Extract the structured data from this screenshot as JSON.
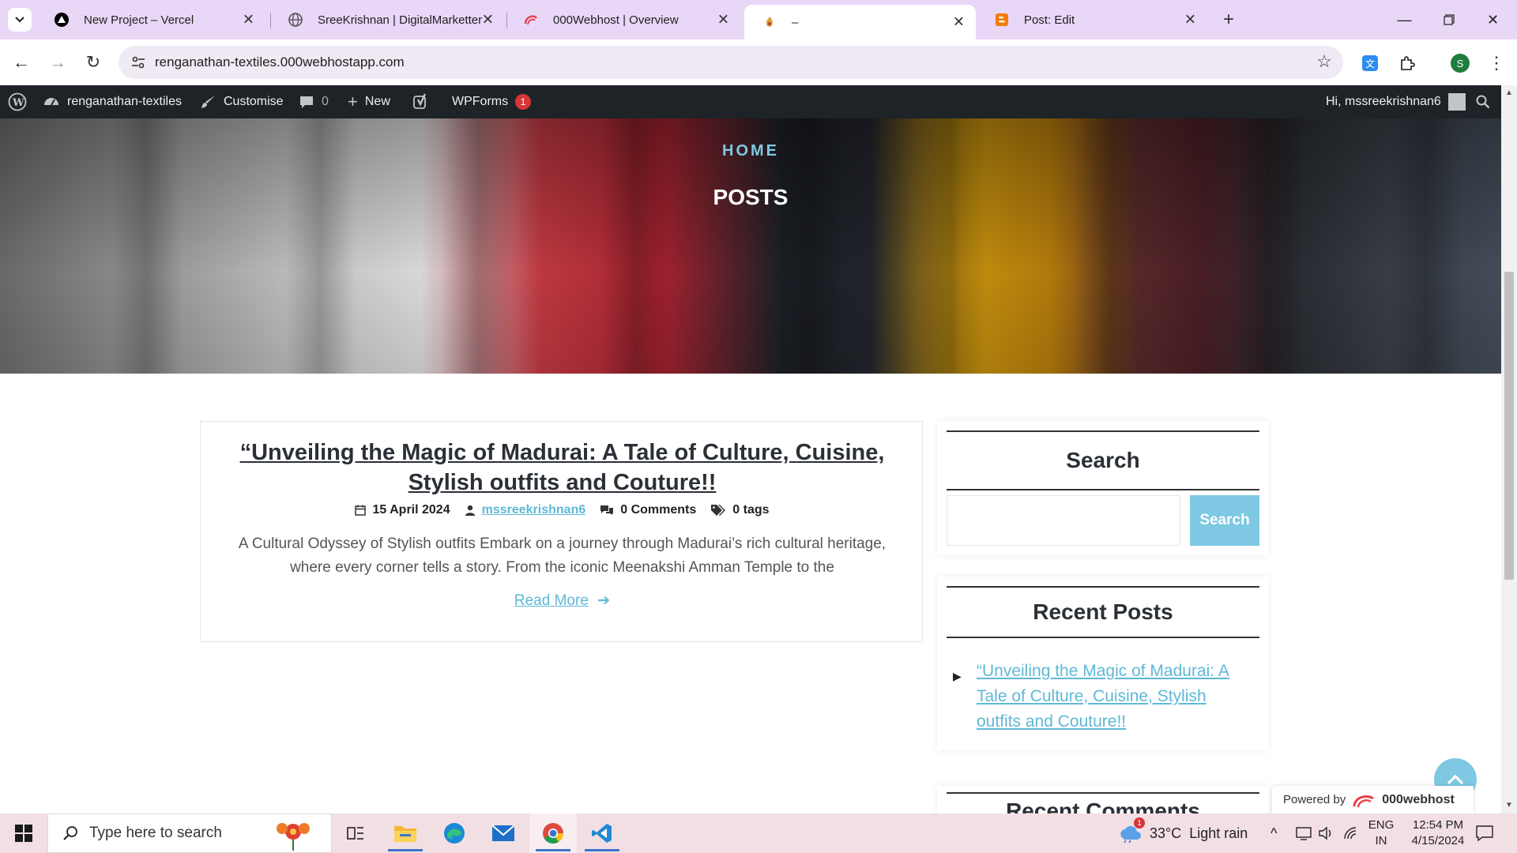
{
  "browser": {
    "tabs": [
      {
        "title": "New Project – Vercel",
        "icon": "vercel-icon",
        "active": false
      },
      {
        "title": "SreeKrishnan | DigitalMarketter",
        "icon": "globe-icon",
        "active": false
      },
      {
        "title": "000Webhost | Overview",
        "icon": "000webhost-icon",
        "active": false
      },
      {
        "title": "–",
        "icon": "page-favicon",
        "active": true
      },
      {
        "title": "Post: Edit",
        "icon": "blogger-icon",
        "active": false
      }
    ],
    "url": "renganathan-textiles.000webhostapp.com",
    "profile_initial": "S"
  },
  "admin_bar": {
    "site_name": "renganathan-textiles",
    "customise": "Customise",
    "comments_count": "0",
    "new_label": "New",
    "wpforms_label": "WPForms",
    "wpforms_badge": "1",
    "greeting": "Hi, mssreekrishnan6"
  },
  "hero": {
    "breadcrumb": "HOME",
    "title": "POSTS"
  },
  "post": {
    "title": "“Unveiling the Magic of Madurai: A Tale of Culture, Cuisine, Stylish outfits and Couture!!",
    "date": "15 April 2024",
    "author": "mssreekrishnan6",
    "comments": "0 Comments",
    "tags": "0 tags",
    "excerpt": "A Cultural Odyssey of Stylish outfits  Embark on a journey through Madurai’s rich cultural heritage, where every corner tells a story. From the iconic Meenakshi Amman Temple to the",
    "read_more": "Read More"
  },
  "sidebar": {
    "search_title": "Search",
    "search_button": "Search",
    "search_value": "",
    "recent_title": "Recent Posts",
    "recent_posts": [
      "“Unveiling the Magic of Madurai: A Tale of Culture, Cuisine, Stylish outfits and Couture!!"
    ],
    "comments_title": "Recent Comments"
  },
  "powered": {
    "label": "Powered by",
    "brand": "000webhost"
  },
  "taskbar": {
    "search_placeholder": "Type here to search",
    "weather_temp": "33°C",
    "weather_desc": "Light rain",
    "weather_badge": "1",
    "lang_top": "ENG",
    "lang_bottom": "IN",
    "time": "12:54 PM",
    "date": "4/15/2024"
  },
  "colors": {
    "accent": "#7ec8e3",
    "link": "#5fb8d6",
    "admin_bar": "#1d2327",
    "tabstrip": "#e8d7f7",
    "taskbar": "#f2dfe4"
  }
}
